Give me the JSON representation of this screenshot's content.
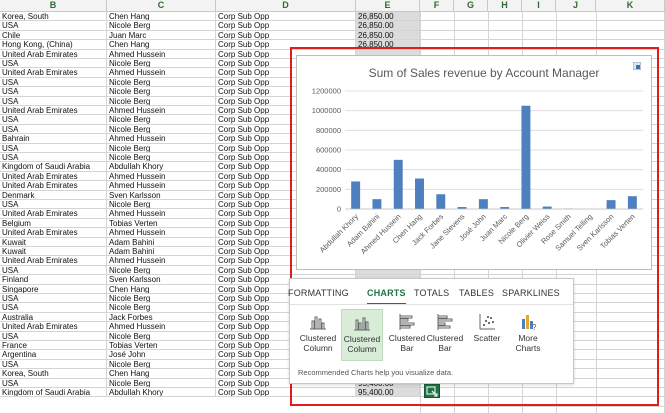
{
  "columns": [
    "B",
    "C",
    "D",
    "E",
    "F",
    "G",
    "H",
    "I",
    "J",
    "K"
  ],
  "rows": [
    [
      "Korea, South",
      "Chen Hang",
      "Corp Sub Opp",
      "26,850.00"
    ],
    [
      "USA",
      "Nicole Berg",
      "Corp Sub Opp",
      "26,850.00"
    ],
    [
      "Chile",
      "Juan Marc",
      "Corp Sub Opp",
      "26,850.00"
    ],
    [
      "Hong Kong, (China)",
      "Chen Hang",
      "Corp Sub Opp",
      "26,850.00"
    ],
    [
      "United Arab Emirates",
      "Ahmed Hussein",
      "Corp Sub Opp",
      ""
    ],
    [
      "USA",
      "Nicole Berg",
      "Corp Sub Opp",
      ""
    ],
    [
      "United Arab Emirates",
      "Ahmed Hussein",
      "Corp Sub Opp",
      ""
    ],
    [
      "USA",
      "Nicole Berg",
      "Corp Sub Opp",
      ""
    ],
    [
      "USA",
      "Nicole Berg",
      "Corp Sub Opp",
      ""
    ],
    [
      "USA",
      "Nicole Berg",
      "Corp Sub Opp",
      ""
    ],
    [
      "United Arab Emirates",
      "Ahmed Hussein",
      "Corp Sub Opp",
      ""
    ],
    [
      "USA",
      "Nicole Berg",
      "Corp Sub Opp",
      ""
    ],
    [
      "USA",
      "Nicole Berg",
      "Corp Sub Opp",
      ""
    ],
    [
      "Bahrain",
      "Ahmed Hussein",
      "Corp Sub Opp",
      ""
    ],
    [
      "USA",
      "Nicole Berg",
      "Corp Sub Opp",
      ""
    ],
    [
      "USA",
      "Nicole Berg",
      "Corp Sub Opp",
      ""
    ],
    [
      "Kingdom of Saudi Arabia",
      "Abdullah Khory",
      "Corp Sub Opp",
      ""
    ],
    [
      "United Arab Emirates",
      "Ahmed Hussein",
      "Corp Sub Opp",
      ""
    ],
    [
      "United Arab Emirates",
      "Ahmed Hussein",
      "Corp Sub Opp",
      ""
    ],
    [
      "Denmark",
      "Sven Karlsson",
      "Corp Sub Opp",
      ""
    ],
    [
      "USA",
      "Nicole Berg",
      "Corp Sub Opp",
      ""
    ],
    [
      "United Arab Emirates",
      "Ahmed Hussein",
      "Corp Sub Opp",
      ""
    ],
    [
      "Belgium",
      "Tobias Verten",
      "Corp Sub Opp",
      ""
    ],
    [
      "United Arab Emirates",
      "Ahmed Hussein",
      "Corp Sub Opp",
      ""
    ],
    [
      "Kuwait",
      "Adam Bahini",
      "Corp Sub Opp",
      ""
    ],
    [
      "Kuwait",
      "Adam Bahini",
      "Corp Sub Opp",
      ""
    ],
    [
      "United Arab Emirates",
      "Ahmed Hussein",
      "Corp Sub Opp",
      ""
    ],
    [
      "USA",
      "Nicole Berg",
      "Corp Sub Opp",
      ""
    ],
    [
      "Finland",
      "Sven Karlsson",
      "Corp Sub Opp",
      ""
    ],
    [
      "Singapore",
      "Chen Hang",
      "Corp Sub Opp",
      ""
    ],
    [
      "USA",
      "Nicole Berg",
      "Corp Sub Opp",
      ""
    ],
    [
      "USA",
      "Nicole Berg",
      "Corp Sub Opp",
      ""
    ],
    [
      "Australia",
      "Jack Forbes",
      "Corp Sub Opp",
      ""
    ],
    [
      "United Arab Emirates",
      "Ahmed Hussein",
      "Corp Sub Opp",
      ""
    ],
    [
      "USA",
      "Nicole Berg",
      "Corp Sub Opp",
      ""
    ],
    [
      "France",
      "Tobias Verten",
      "Corp Sub Opp",
      ""
    ],
    [
      "Argentina",
      "José John",
      "Corp Sub Opp",
      ""
    ],
    [
      "USA",
      "Nicole Berg",
      "Corp Sub Opp",
      ""
    ],
    [
      "Korea, South",
      "Chen Hang",
      "Corp Sub Opp",
      ""
    ],
    [
      "USA",
      "Nicole Berg",
      "Corp Sub Opp",
      "95,400.00"
    ],
    [
      "Kingdom of Saudi Arabia",
      "Abdullah Khory",
      "Corp Sub Opp",
      "95,400.00"
    ]
  ],
  "quick_analysis": {
    "tabs": [
      "FORMATTING",
      "CHARTS",
      "TOTALS",
      "TABLES",
      "SPARKLINES"
    ],
    "active_tab": "CHARTS",
    "items": [
      {
        "label1": "Clustered",
        "label2": "Column",
        "icon": "clustered-column-icon"
      },
      {
        "label1": "Clustered",
        "label2": "Column",
        "icon": "clustered-column-icon"
      },
      {
        "label1": "Clustered",
        "label2": "Bar",
        "icon": "clustered-bar-icon"
      },
      {
        "label1": "Clustered",
        "label2": "Bar",
        "icon": "clustered-bar-icon"
      },
      {
        "label1": "Scatter",
        "label2": "",
        "icon": "scatter-icon"
      },
      {
        "label1": "More",
        "label2": "Charts",
        "icon": "more-charts-icon"
      }
    ],
    "note": "Recommended Charts help you visualize data."
  },
  "colors": {
    "bar": "#4e7fbf",
    "accent": "#217346",
    "frame": "#e21b1b"
  },
  "chart_data": {
    "type": "bar",
    "title": "Sum of Sales revenue by Account Manager",
    "categories": [
      "Abdullah Khory",
      "Adam Bahini",
      "Ahmed Hussein",
      "Chen Hang",
      "Jack Forbes",
      "Jane Stevens",
      "José John",
      "Juan Marc",
      "Nicole Berg",
      "Olivier Weiss",
      "Rose Smith",
      "Samuel Telling",
      "Sven Karlsson",
      "Tobias Verten"
    ],
    "values": [
      280000,
      100000,
      500000,
      310000,
      150000,
      20000,
      100000,
      20000,
      1050000,
      25000,
      5000,
      0,
      90000,
      130000
    ],
    "yticks": [
      "0",
      "200000",
      "400000",
      "600000",
      "800000",
      "1000000",
      "1200000"
    ],
    "ylim": [
      0,
      1200000
    ],
    "xlabel": "",
    "ylabel": "",
    "grid": true
  }
}
